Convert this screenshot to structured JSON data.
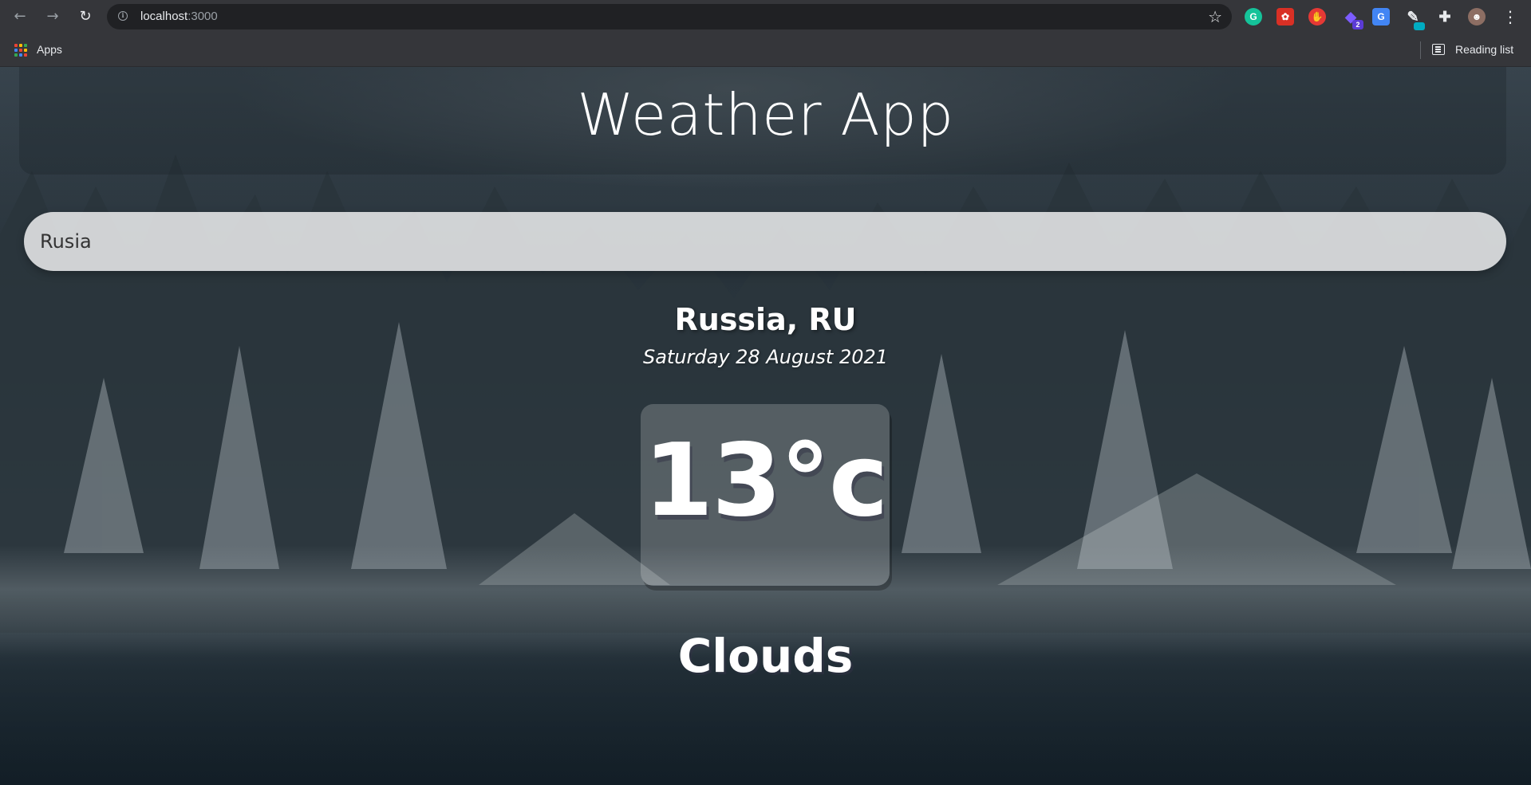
{
  "browser": {
    "url_host": "localhost",
    "url_port": ":3000",
    "bookmarks": {
      "apps_label": "Apps",
      "reading_list_label": "Reading list"
    },
    "extensions": [
      {
        "name": "grammarly-icon",
        "glyph": "G",
        "color": "#15c39a"
      },
      {
        "name": "ext-red-icon",
        "glyph": "✿",
        "color": "#d93025"
      },
      {
        "name": "adblock-icon",
        "glyph": "✋",
        "color": "#e53935"
      },
      {
        "name": "ext-purple-icon",
        "glyph": "◆",
        "color": "#5b3bd6",
        "badge": "2"
      },
      {
        "name": "google-translate-icon",
        "glyph": "G",
        "color": "#4285f4"
      },
      {
        "name": "ext-pen-icon",
        "glyph": "✎",
        "color": "#35363a"
      }
    ],
    "icons": {
      "back": "back-arrow-icon",
      "forward": "forward-arrow-icon",
      "reload": "reload-icon",
      "star": "bookmark-star-icon",
      "puzzle": "extensions-puzzle-icon",
      "menu": "kebab-menu-icon"
    }
  },
  "app": {
    "title": "Weather App",
    "search_value": "Rusia",
    "location": "Russia, RU",
    "date": "Saturday 28 August 2021",
    "temperature": "13°c",
    "condition": "Clouds"
  }
}
